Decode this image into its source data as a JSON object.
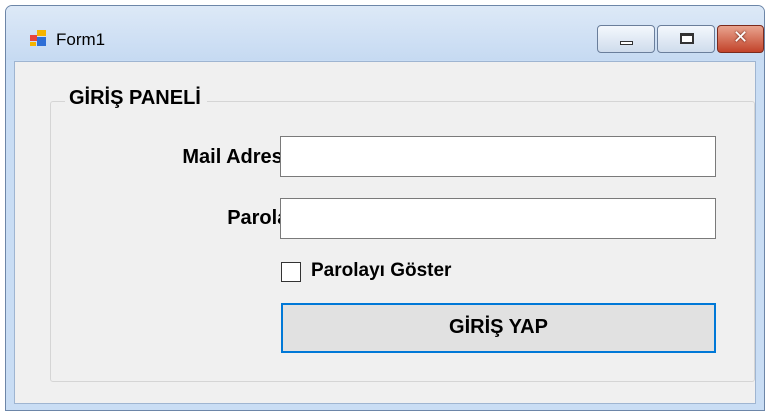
{
  "window": {
    "title": "Form1",
    "icon": "form-app-icon",
    "controls": {
      "minimize_icon": "minimize-icon",
      "maximize_icon": "maximize-icon",
      "close_glyph": "✕"
    }
  },
  "panel": {
    "title": "GİRİŞ PANELİ"
  },
  "form": {
    "mail_label": "Mail Adresi:",
    "mail_value": "",
    "password_label": "Parola:",
    "password_value": "",
    "show_password_label": "Parolayı Göster",
    "show_password_checked": false,
    "submit_label": "GİRİŞ YAP"
  },
  "colors": {
    "accent": "#0078d7",
    "form_background": "#f0f0f0",
    "close_button": "#c2432a"
  }
}
